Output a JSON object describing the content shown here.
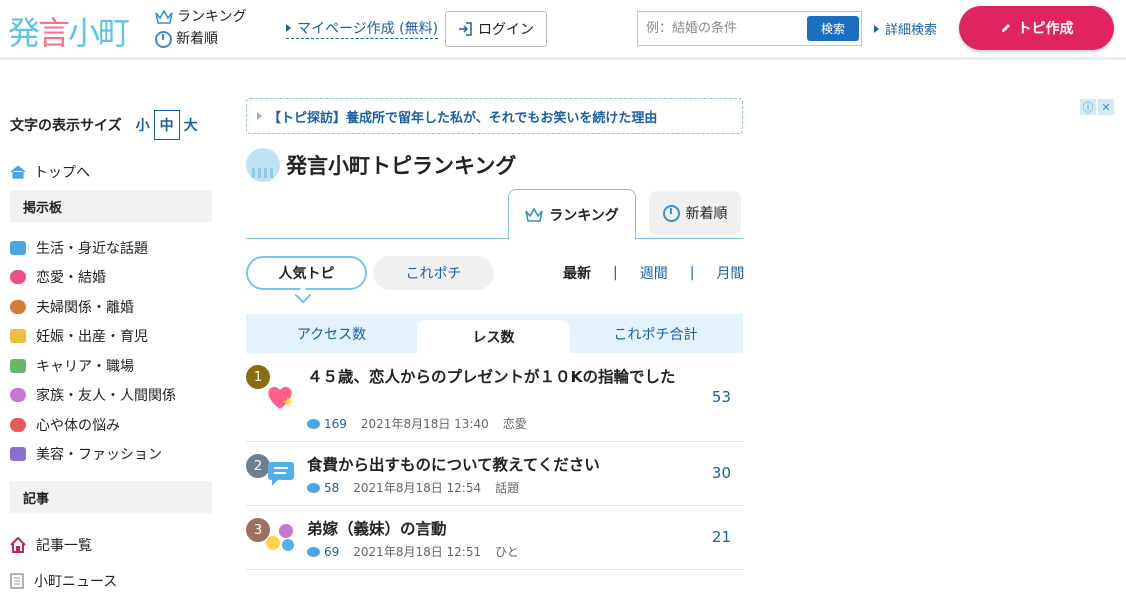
{
  "header": {
    "logo_text": "発言小町",
    "nav_ranking": "ランキング",
    "nav_new": "新着順",
    "mypage_link": "マイページ作成 (無料)",
    "login_label": "ログイン",
    "search_placeholder": "例：結婚の条件",
    "search_button": "検索",
    "advanced_search": "詳細検索",
    "create_topic": "トピ作成",
    "accent_color": "#e0245e"
  },
  "sidebar": {
    "font_size_label": "文字の表示サイズ",
    "font_sizes": [
      "小",
      "中",
      "大"
    ],
    "font_size_selected": "中",
    "top_link": "トップへ",
    "board_heading": "掲示板",
    "board_items": [
      {
        "label": "生活・身近な話題",
        "icon": "speech-bubble-icon",
        "color": "#4aa6df"
      },
      {
        "label": "恋愛・結婚",
        "icon": "heart-icon",
        "color": "#e8508a"
      },
      {
        "label": "夫婦関係・離婚",
        "icon": "couple-icon",
        "color": "#d47a3a"
      },
      {
        "label": "妊娠・出産・育児",
        "icon": "baby-bottle-icon",
        "color": "#e8c23a"
      },
      {
        "label": "キャリア・職場",
        "icon": "picture-icon",
        "color": "#6bb56b"
      },
      {
        "label": "家族・友人・人間関係",
        "icon": "people-icon",
        "color": "#c678d0"
      },
      {
        "label": "心や体の悩み",
        "icon": "person-icon",
        "color": "#e85a5a"
      },
      {
        "label": "美容・ファッション",
        "icon": "cosmetics-icon",
        "color": "#8a6fd0"
      }
    ],
    "articles_heading": "記事",
    "article_items": [
      {
        "label": "記事一覧",
        "icon": "home-icon"
      },
      {
        "label": "小町ニュース",
        "icon": "document-icon"
      }
    ]
  },
  "main": {
    "banner_text": "【トピ探訪】養成所で留年した私が、それでもお笑いを続けた理由",
    "ranking_title": "発言小町トピランキング",
    "tab_ranking": "ランキング",
    "tab_new": "新着順",
    "pill_popular": "人気トピ",
    "pill_korepochi": "これポチ",
    "periods": [
      "最新",
      "週間",
      "月間"
    ],
    "period_selected": "最新",
    "sort_tabs": [
      "アクセス数",
      "レス数",
      "これポチ合計"
    ],
    "sort_selected": "レス数",
    "rows": [
      {
        "rank": "1",
        "badge_color": "#8a6d10",
        "icon": "heart-sparkle-icon",
        "title": "４５歳、恋人からのプレゼントが１０Kの指輪でした",
        "comments": "169",
        "date": "2021年8月18日 13:40",
        "category": "恋愛",
        "count": "53"
      },
      {
        "rank": "2",
        "badge_color": "#6e7e8c",
        "icon": "chat-bubbles-icon",
        "title": "食費から出すものについて教えてください",
        "comments": "58",
        "date": "2021年8月18日 12:54",
        "category": "話題",
        "count": "30"
      },
      {
        "rank": "3",
        "badge_color": "#9a7060",
        "icon": "faces-icon",
        "title": "弟嫁（義妹）の言動",
        "comments": "69",
        "date": "2021年8月18日 12:51",
        "category": "ひと",
        "count": "21"
      }
    ]
  }
}
